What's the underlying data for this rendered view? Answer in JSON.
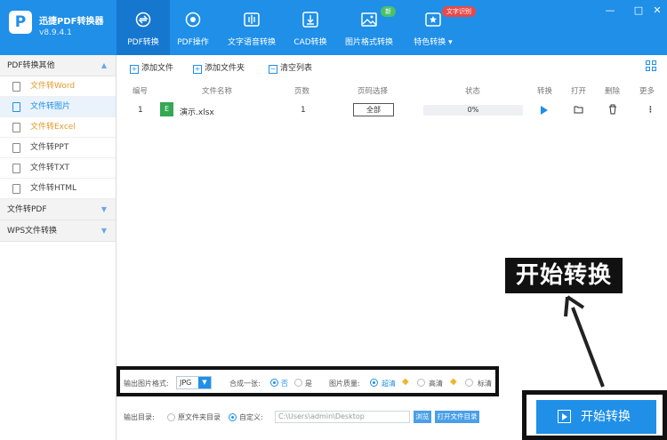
{
  "app": {
    "name": "迅捷PDF转换器",
    "version": "v8.9.4.1",
    "logo_letter": "P"
  },
  "nav": [
    {
      "label": "PDF转换",
      "active": true
    },
    {
      "label": "PDF操作"
    },
    {
      "label": "文字语音转换"
    },
    {
      "label": "CAD转换"
    },
    {
      "label": "图片格式转换",
      "badge": "新"
    },
    {
      "label": "特色转换 ▾",
      "badge": "文字识别"
    }
  ],
  "window": {
    "minimize": "—",
    "restore": "□",
    "close": "✕"
  },
  "sidebar": {
    "group1": "PDF转换其他",
    "items": [
      "文件转Word",
      "文件转图片",
      "文件转Excel",
      "文件转PPT",
      "文件转TXT",
      "文件转HTML"
    ],
    "group2": "文件转PDF",
    "group3": "WPS文件转换"
  },
  "toolbar": {
    "add_file": "添加文件",
    "add_folder": "添加文件夹",
    "clear": "清空列表"
  },
  "table": {
    "headers": [
      "编号",
      "文件名称",
      "页数",
      "页码选择",
      "状态",
      "转换",
      "打开",
      "删除",
      "更多"
    ],
    "rows": [
      {
        "no": "1",
        "file_icon": "E",
        "name": "演示.xlsx",
        "pages": "1",
        "page_sel": "全部",
        "status": "0%",
        "progress": 0
      }
    ]
  },
  "options": {
    "format_label": "输出图片格式:",
    "format_value": "JPG",
    "merge_label": "合成一张:",
    "merge_no": "否",
    "merge_yes": "是",
    "quality_label": "图片质量:",
    "q1": "超清",
    "q2": "高清",
    "q3": "标清"
  },
  "output": {
    "label": "输出目录:",
    "original": "原文件夹目录",
    "custom": "自定义:",
    "path": "C:\\Users\\admin\\Desktop",
    "browse": "浏览",
    "open": "打开文件目录"
  },
  "start_button": "开始转换",
  "callout": "开始转换",
  "colors": {
    "primary": "#1f8fe8",
    "badge_green": "#4cc06a",
    "badge_red": "#e84a4a",
    "excel": "#34a853"
  }
}
